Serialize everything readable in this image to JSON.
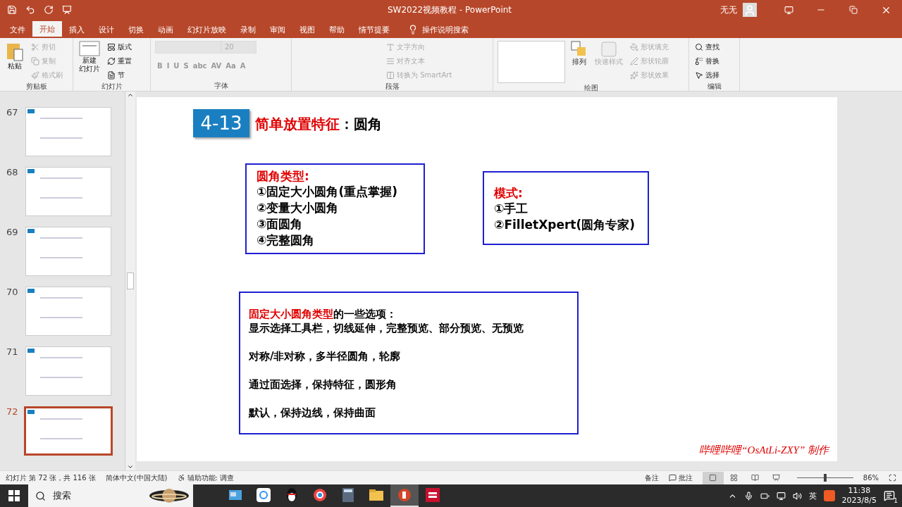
{
  "window": {
    "title": "SW2022视频教程  -  PowerPoint",
    "user": "无无"
  },
  "tabs": [
    {
      "label": "文件",
      "selected": false
    },
    {
      "label": "开始",
      "selected": true
    },
    {
      "label": "插入",
      "selected": false
    },
    {
      "label": "设计",
      "selected": false
    },
    {
      "label": "切换",
      "selected": false
    },
    {
      "label": "动画",
      "selected": false
    },
    {
      "label": "幻灯片放映",
      "selected": false
    },
    {
      "label": "录制",
      "selected": false
    },
    {
      "label": "审阅",
      "selected": false
    },
    {
      "label": "视图",
      "selected": false
    },
    {
      "label": "帮助",
      "selected": false
    },
    {
      "label": "情节提要",
      "selected": false
    }
  ],
  "tell_me": "操作说明搜索",
  "ribbon": {
    "clipboard": {
      "label": "剪贴板",
      "paste": "粘贴",
      "items": [
        {
          "kind": "cut",
          "label": "剪切",
          "disabled": true
        },
        {
          "kind": "copy",
          "label": "复制",
          "disabled": true
        },
        {
          "kind": "painter",
          "label": "格式刷",
          "disabled": true
        }
      ]
    },
    "slides": {
      "label": "幻灯片",
      "new_slide": [
        "新建",
        "幻灯片"
      ],
      "items": [
        {
          "kind": "layout",
          "label": "版式",
          "disabled": false
        },
        {
          "kind": "reset",
          "label": "重置",
          "disabled": false
        },
        {
          "kind": "section",
          "label": "节",
          "disabled": false
        }
      ]
    },
    "font": {
      "label": "字体",
      "size": "20",
      "buttons": [
        "B",
        "I",
        "U",
        "S",
        "abc",
        "AV",
        "Aa",
        "A"
      ]
    },
    "paragraph": {
      "label": "段落",
      "items": [
        {
          "kind": "direction",
          "label": "文字方向",
          "disabled": true
        },
        {
          "kind": "align",
          "label": "对齐文本",
          "disabled": true
        },
        {
          "kind": "smartart",
          "label": "转换为 SmartArt",
          "disabled": true
        }
      ]
    },
    "drawing": {
      "label": "绘图",
      "arrange": "排列",
      "quick_styles": "快速样式",
      "items": [
        {
          "kind": "fill",
          "label": "形状填充",
          "disabled": true
        },
        {
          "kind": "outline",
          "label": "形状轮廓",
          "disabled": true
        },
        {
          "kind": "effect",
          "label": "形状效果",
          "disabled": true
        }
      ]
    },
    "editing": {
      "label": "编辑",
      "items": [
        {
          "kind": "find",
          "label": "查找",
          "disabled": false
        },
        {
          "kind": "replace",
          "label": "替换",
          "disabled": false
        },
        {
          "kind": "select",
          "label": "选择",
          "disabled": false
        }
      ]
    }
  },
  "thumbnails": [
    {
      "number": "67",
      "selected": false
    },
    {
      "number": "68",
      "selected": false
    },
    {
      "number": "69",
      "selected": false
    },
    {
      "number": "70",
      "selected": false
    },
    {
      "number": "71",
      "selected": false
    },
    {
      "number": "72",
      "selected": true
    }
  ],
  "slide": {
    "badge": "4-13",
    "title": {
      "highlight": "简单放置特征",
      "rest": "：圆角"
    },
    "boxes": [
      {
        "heading": "圆角类型:",
        "lines": [
          "①固定大小圆角(重点掌握)",
          "②变量大小圆角",
          "③面圆角",
          "④完整圆角"
        ]
      },
      {
        "heading": "模式:",
        "lines": [
          "①手工",
          "②FilletXpert(圆角专家)"
        ]
      }
    ],
    "options": {
      "highlight": "固定大小圆角类型",
      "rest": "的一些选项：",
      "lines": [
        "显示选择工具栏，切线延伸，完整预览、部分预览、无预览",
        "对称/非对称，多半径圆角，轮廓",
        "通过面选择，保持特征，圆形角",
        "默认，保持边线，保持曲面"
      ]
    },
    "footer": "哔哩哔哩“OsAtLi-ZXY” 制作"
  },
  "status_bar": {
    "slide_info": "幻灯片 第 72 张，共 116 张",
    "language": "简体中文(中国大陆)",
    "accessibility": "辅助功能: 调查",
    "notes": "备注",
    "comments": "批注",
    "views": [
      {
        "kind": "normal",
        "selected": true
      },
      {
        "kind": "sorter",
        "selected": false
      },
      {
        "kind": "reading",
        "selected": false
      },
      {
        "kind": "show",
        "selected": false
      }
    ],
    "zoom": {
      "level": 0.5,
      "reading": "86%"
    }
  },
  "taskbar": {
    "search": "搜索",
    "apps": [
      {
        "kind": "window",
        "active": false
      },
      {
        "kind": "cloud",
        "active": false
      },
      {
        "kind": "penguin",
        "active": false
      },
      {
        "kind": "browser",
        "active": false
      },
      {
        "kind": "calculator",
        "active": false
      },
      {
        "kind": "folder",
        "active": false
      },
      {
        "kind": "powerpoint",
        "active": true
      },
      {
        "kind": "sw",
        "active": false
      }
    ],
    "ime": "英",
    "time": "11:38",
    "date": "2023/8/5",
    "notifications": "1"
  }
}
